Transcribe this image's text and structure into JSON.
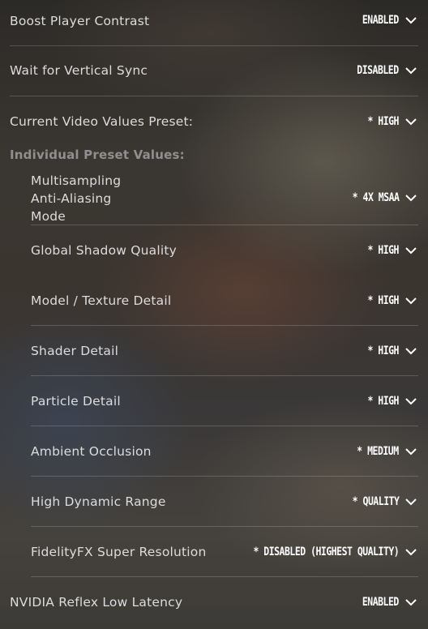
{
  "settings": {
    "boost_player_contrast": {
      "label": "Boost Player Contrast",
      "value": "ENABLED"
    },
    "wait_vertical_sync": {
      "label": "Wait for Vertical Sync",
      "value": "DISABLED"
    },
    "current_preset": {
      "label": "Current Video Values Preset:",
      "value": "* HIGH"
    },
    "section_title": "Individual Preset Values:",
    "multisampling": {
      "label": "Multisampling Anti-Aliasing Mode",
      "value": "* 4X MSAA"
    },
    "global_shadow": {
      "label": "Global Shadow Quality",
      "value": "* HIGH"
    },
    "model_texture": {
      "label": "Model / Texture Detail",
      "value": "* HIGH"
    },
    "shader_detail": {
      "label": "Shader Detail",
      "value": "* HIGH"
    },
    "particle_detail": {
      "label": "Particle Detail",
      "value": "* HIGH"
    },
    "ambient_occlusion": {
      "label": "Ambient Occlusion",
      "value": "* MEDIUM"
    },
    "high_dynamic_range": {
      "label": "High Dynamic Range",
      "value": "* QUALITY"
    },
    "fidelityfx": {
      "label": "FidelityFX Super Resolution",
      "value": "* DISABLED (HIGHEST QUALITY)"
    },
    "nvidia_reflex": {
      "label": "NVIDIA Reflex Low Latency",
      "value": "ENABLED"
    }
  },
  "icons": {
    "dropdown": "chevron-down-icon"
  }
}
